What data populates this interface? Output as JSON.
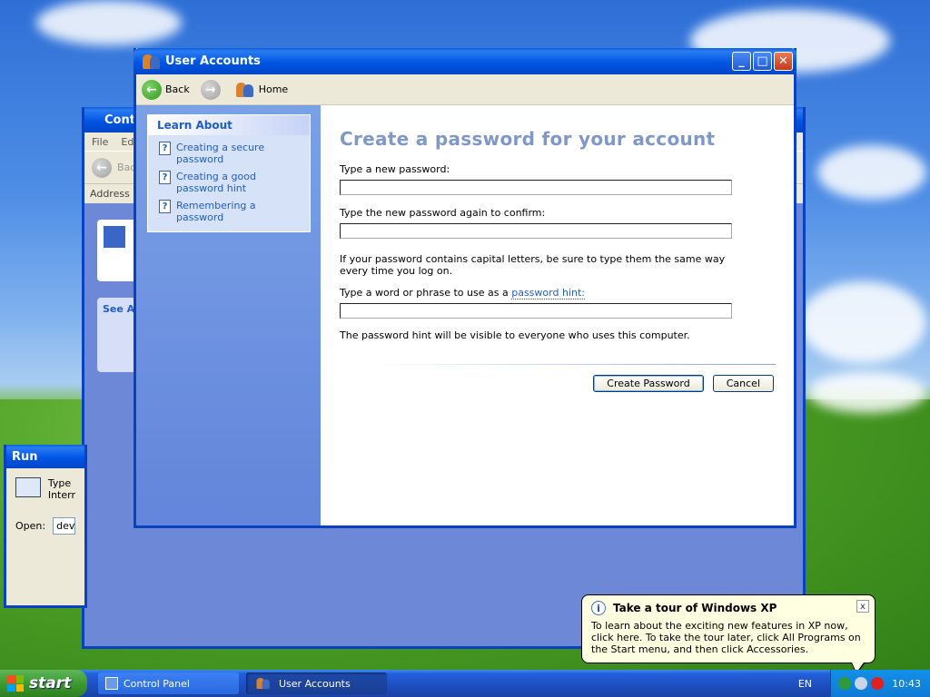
{
  "window": {
    "title": "User Accounts"
  },
  "caption_buttons": {
    "minimize": "_",
    "maximize": "□",
    "close": "✕"
  },
  "nav": {
    "back_label": "Back",
    "home_label": "Home"
  },
  "learn_about": {
    "heading": "Learn About",
    "items": [
      {
        "label": "Creating a secure password"
      },
      {
        "label": "Creating a good password hint"
      },
      {
        "label": "Remembering a password"
      }
    ]
  },
  "form": {
    "heading": "Create a password for your account",
    "new_password_label": "Type a new password:",
    "new_password_value": "",
    "confirm_label": "Type the new password again to confirm:",
    "confirm_value": "",
    "caps_note": "If your password contains capital letters, be sure to type them the same way every time you log on.",
    "hint_label_prefix": "Type a word or phrase to use as a",
    "hint_link": "password hint:",
    "hint_value": "",
    "hint_note": "The password hint will be visible to everyone who uses this computer.",
    "create_button": "Create Password",
    "cancel_button": "Cancel"
  },
  "background_windows": {
    "control_panel": {
      "title": "Contr",
      "menu": [
        "File",
        "Edi"
      ],
      "back": "Bac",
      "address_label": "Address",
      "see_also": "See A"
    },
    "run": {
      "title": "Run",
      "desc": "Type\nInterr",
      "open_label": "Open:",
      "open_value": "devg"
    }
  },
  "taskbar": {
    "start": "start",
    "items": [
      {
        "label": "Control Panel"
      },
      {
        "label": "User Accounts"
      }
    ],
    "language": "EN",
    "clock": "10:43"
  },
  "balloon": {
    "title": "Take a tour of Windows XP",
    "text": "To learn about the exciting new features in XP now, click here. To take the tour later, click All Programs on the Start menu, and then click Accessories.",
    "close": "x"
  }
}
